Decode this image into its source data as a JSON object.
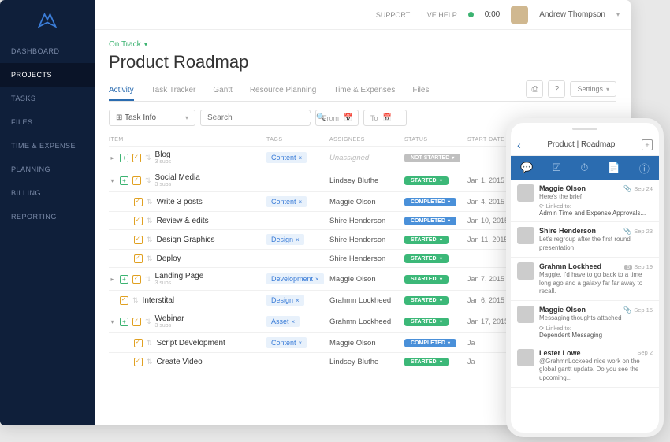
{
  "topbar": {
    "support": "SUPPORT",
    "livehelp": "LIVE HELP",
    "timer": "0:00",
    "user": "Andrew Thompson"
  },
  "sidebar": {
    "items": [
      "DASHBOARD",
      "PROJECTS",
      "TASKS",
      "FILES",
      "TIME & EXPENSE",
      "PLANNING",
      "BILLING",
      "REPORTING"
    ],
    "active": 1
  },
  "header": {
    "status": "On Track",
    "title": "Product Roadmap"
  },
  "tabs": {
    "items": [
      "Activity",
      "Task Tracker",
      "Gantt",
      "Resource Planning",
      "Time & Expenses",
      "Files"
    ],
    "active": 0,
    "settings": "Settings"
  },
  "filters": {
    "taskinfo": "Task Info",
    "search_ph": "Search",
    "from": "From",
    "to": "To"
  },
  "columns": {
    "item": "ITEM",
    "tags": "TAGS",
    "assign": "ASSIGNEES",
    "status": "STATUS",
    "date": "START DATE"
  },
  "rows": [
    {
      "level": 0,
      "expand": "▸",
      "name": "Blog",
      "subs": "3 subs",
      "tag": "Content",
      "assignee": "Unassigned",
      "unassigned": true,
      "status": "NOT STARTED",
      "statusType": "notstarted",
      "date": ""
    },
    {
      "level": 0,
      "expand": "▾",
      "name": "Social Media",
      "subs": "3 subs",
      "tag": "",
      "assignee": "Lindsey Bluthe",
      "status": "STARTED",
      "statusType": "started",
      "date": "Jan 1, 2015"
    },
    {
      "level": 1,
      "name": "Write 3 posts",
      "tag": "Content",
      "assignee": "Maggie Olson",
      "status": "COMPLETED",
      "statusType": "completed",
      "date": "Jan 4, 2015"
    },
    {
      "level": 1,
      "name": "Review & edits",
      "tag": "",
      "assignee": "Shire Henderson",
      "status": "COMPLETED",
      "statusType": "completed",
      "date": "Jan 10, 2015"
    },
    {
      "level": 1,
      "name": "Design Graphics",
      "tag": "Design",
      "assignee": "Shire Henderson",
      "status": "STARTED",
      "statusType": "started",
      "date": "Jan 11, 2015"
    },
    {
      "level": 1,
      "name": "Deploy",
      "tag": "",
      "assignee": "Shire Henderson",
      "status": "STARTED",
      "statusType": "started",
      "date": ""
    },
    {
      "level": 0,
      "expand": "▸",
      "name": "Landing Page",
      "subs": "3 subs",
      "tag": "Development",
      "assignee": "Maggie Olson",
      "status": "STARTED",
      "statusType": "started",
      "date": "Jan 7, 2015"
    },
    {
      "level": 0,
      "name": "Interstital",
      "tag": "Design",
      "assignee": "Grahmn Lockheed",
      "status": "STARTED",
      "statusType": "started",
      "date": "Jan 6, 2015"
    },
    {
      "level": 0,
      "expand": "▾",
      "name": "Webinar",
      "subs": "3 subs",
      "tag": "Asset",
      "assignee": "Grahmn Lockheed",
      "status": "STARTED",
      "statusType": "started",
      "date": "Jan 17, 2015"
    },
    {
      "level": 1,
      "name": "Script Development",
      "tag": "Content",
      "assignee": "Maggie Olson",
      "status": "COMPLETED",
      "statusType": "completed",
      "date": "Ja"
    },
    {
      "level": 1,
      "name": "Create Video",
      "tag": "",
      "assignee": "Lindsey Bluthe",
      "status": "STARTED",
      "statusType": "started",
      "date": "Ja"
    }
  ],
  "phone": {
    "title": "Product | Roadmap",
    "messages": [
      {
        "name": "Maggie Olson",
        "date": "Sep 24",
        "text": "Here's the brief",
        "link": "Linked to:",
        "linkTarget": "Admin Time and Expense Approvals...",
        "clip": true
      },
      {
        "name": "Shire Henderson",
        "date": "Sep 23",
        "text": "Let's regroup after the first round presentation",
        "clip": true
      },
      {
        "name": "Grahmn Lockheed",
        "date": "Sep 19",
        "text": "Maggie, I'd have to go back to a time long ago and a galaxy far far away to recall.",
        "badge": "6"
      },
      {
        "name": "Maggie Olson",
        "date": "Sep 15",
        "text": "Messaging thoughts attached",
        "link": "Linked to:",
        "linkTarget": "Dependent Messaging",
        "clip": true
      },
      {
        "name": "Lester Lowe",
        "date": "Sep 2",
        "text": "@GrahmnLockeed nice work on the global gantt update. Do you see the upcoming..."
      }
    ]
  }
}
